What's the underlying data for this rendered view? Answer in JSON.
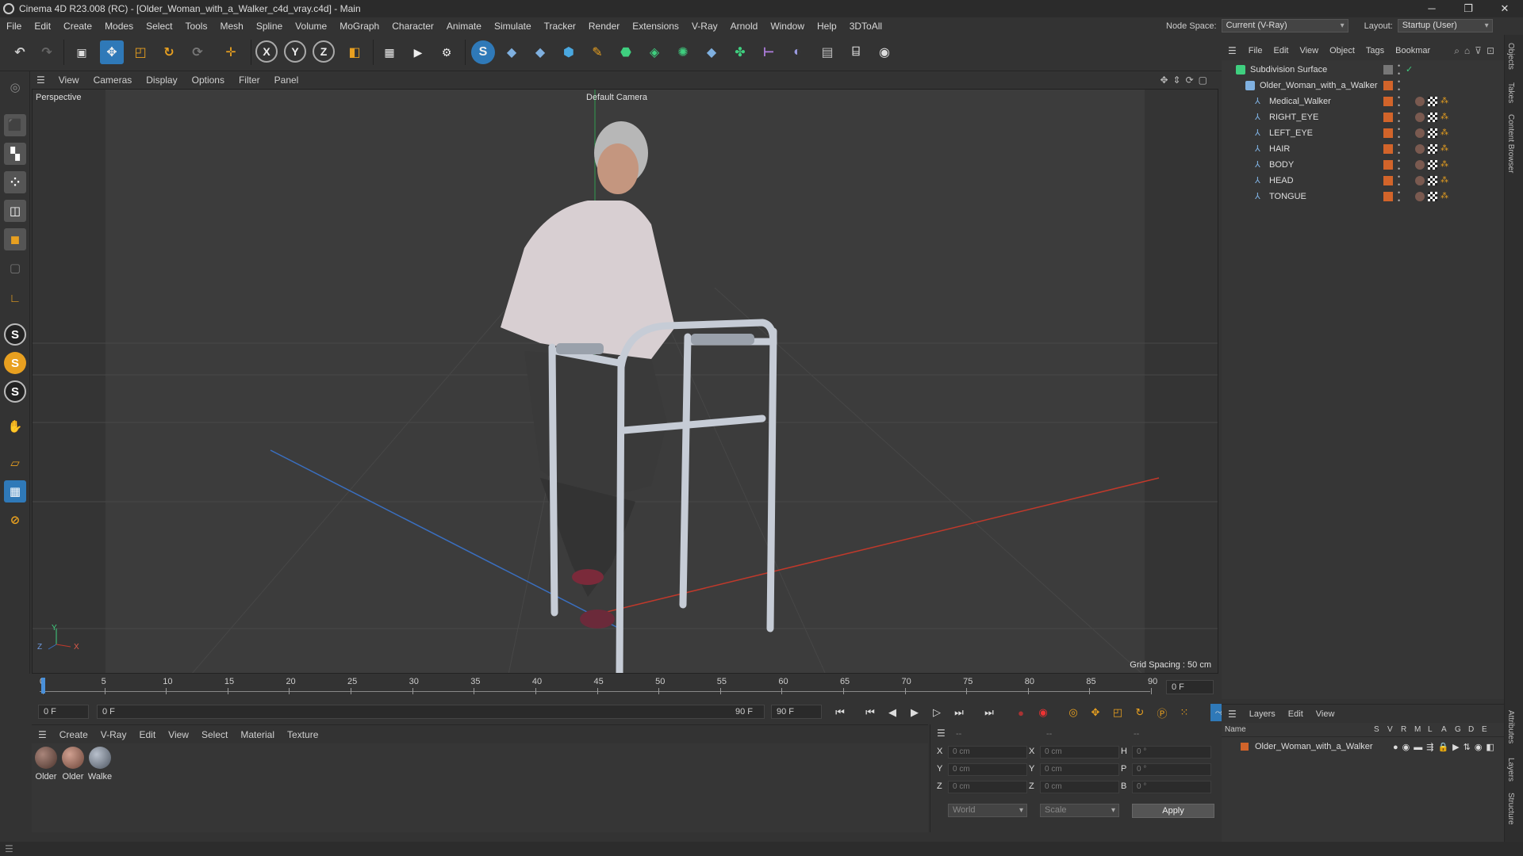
{
  "window": {
    "title": "Cinema 4D R23.008 (RC) - [Older_Woman_with_a_Walker_c4d_vray.c4d] - Main",
    "minimize": "─",
    "restore": "❐",
    "close": "✕"
  },
  "menubar": {
    "items": [
      "File",
      "Edit",
      "Create",
      "Modes",
      "Select",
      "Tools",
      "Mesh",
      "Spline",
      "Volume",
      "MoGraph",
      "Character",
      "Animate",
      "Simulate",
      "Tracker",
      "Render",
      "Extensions",
      "V-Ray",
      "Arnold",
      "Window",
      "Help",
      "3DToAll"
    ],
    "node_space_label": "Node Space:",
    "node_space_value": "Current (V-Ray)",
    "layout_label": "Layout:",
    "layout_value": "Startup (User)"
  },
  "viewport": {
    "menu": [
      "View",
      "Cameras",
      "Display",
      "Options",
      "Filter",
      "Panel"
    ],
    "view_name": "Perspective",
    "camera_name": "Default Camera",
    "grid_spacing": "Grid Spacing : 50 cm",
    "axis_labels": {
      "x": "X",
      "y": "Y",
      "z": "Z"
    }
  },
  "timeline": {
    "ticks": [
      "0",
      "5",
      "10",
      "15",
      "20",
      "25",
      "30",
      "35",
      "40",
      "45",
      "50",
      "55",
      "60",
      "65",
      "70",
      "75",
      "80",
      "85",
      "90"
    ],
    "current_frame": "0 F",
    "start_frame": "0 F",
    "range_start": "0 F",
    "range_end": "90 F",
    "end_frame": "90 F"
  },
  "material_manager": {
    "menu": [
      "Create",
      "V-Ray",
      "Edit",
      "View",
      "Select",
      "Material",
      "Texture"
    ],
    "materials": [
      {
        "label": "Older",
        "color": "#6b4e46"
      },
      {
        "label": "Older",
        "color": "#9a6b5c"
      },
      {
        "label": "Walke",
        "color": "#7f8894"
      }
    ]
  },
  "coordinates": {
    "header": [
      "--",
      "--",
      "--"
    ],
    "rows": [
      {
        "axis": "X",
        "pos": "0 cm",
        "saxis": "X",
        "size": "0 cm",
        "raxis": "H",
        "rot": "0 °"
      },
      {
        "axis": "Y",
        "pos": "0 cm",
        "saxis": "Y",
        "size": "0 cm",
        "raxis": "P",
        "rot": "0 °"
      },
      {
        "axis": "Z",
        "pos": "0 cm",
        "saxis": "Z",
        "size": "0 cm",
        "raxis": "B",
        "rot": "0 °"
      }
    ],
    "space": "World",
    "mode": "Scale",
    "apply": "Apply"
  },
  "object_manager": {
    "menu": [
      "File",
      "Edit",
      "View",
      "Object",
      "Tags",
      "Bookmar"
    ],
    "objects": [
      {
        "name": "Subdivision Surface",
        "level": 0
      },
      {
        "name": "Older_Woman_with_a_Walker",
        "level": 1
      },
      {
        "name": "Medical_Walker",
        "level": 2
      },
      {
        "name": "RIGHT_EYE",
        "level": 2
      },
      {
        "name": "LEFT_EYE",
        "level": 2
      },
      {
        "name": "HAIR",
        "level": 2
      },
      {
        "name": "BODY",
        "level": 2
      },
      {
        "name": "HEAD",
        "level": 2
      },
      {
        "name": "TONGUE",
        "level": 2
      }
    ]
  },
  "side_tabs": [
    "Objects",
    "Takes",
    "Content Browser",
    "Attributes",
    "Layers",
    "Structure"
  ],
  "layer_manager": {
    "menu": [
      "Layers",
      "Edit",
      "View"
    ],
    "columns": [
      "Name",
      "S",
      "V",
      "R",
      "M",
      "L",
      "A",
      "G",
      "D",
      "E"
    ],
    "layers": [
      {
        "name": "Older_Woman_with_a_Walker",
        "color": "#d2642a"
      }
    ]
  },
  "colors": {
    "accent_orange": "#d2642a",
    "toolbar_blue": "#2f79b8",
    "axis_x": "#c0392b",
    "axis_z": "#3a6fc0"
  }
}
